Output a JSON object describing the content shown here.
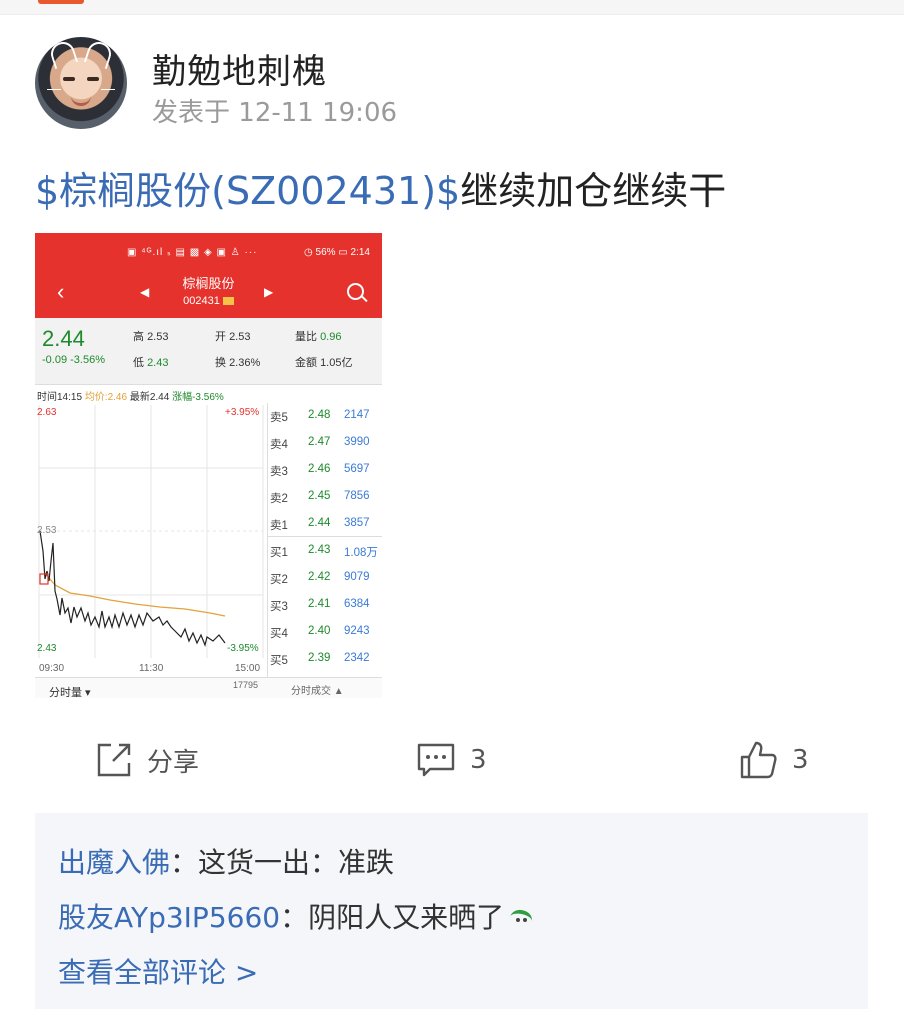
{
  "post": {
    "username": "勤勉地刺槐",
    "time_prefix": "发表于",
    "time": "12-11 19:06",
    "stock_link": "$棕榈股份(SZ002431)$",
    "text": "继续加仓继续干"
  },
  "screenshot": {
    "status_icons": "▣ ⁴ᴳ.ıl ₛ ▤ ▩ ◈ ▣ ♙ ···",
    "status_right": "◷ 56% ▭ 2:14",
    "stock_name": "棕榈股份",
    "stock_code": "002431",
    "price": "2.44",
    "change": "-0.09 -3.56%",
    "high_label": "高",
    "high": "2.53",
    "open_label": "开",
    "open": "2.53",
    "vol_ratio_label": "量比",
    "vol_ratio": "0.96",
    "low_label": "低",
    "low": "2.43",
    "turnover_label": "换",
    "turnover": "2.36%",
    "amount_label": "金额",
    "amount": "1.05亿",
    "info_time": "时间14:15",
    "info_avg": "均价:2.46",
    "info_latest": "最新2.44",
    "info_pct": "涨幅-3.56%",
    "chart_max": "2.63",
    "chart_max_pct": "+3.95%",
    "chart_mid": "2.53",
    "chart_min": "2.43",
    "chart_min_pct": "-3.95%",
    "time_start": "09:30",
    "time_mid": "11:30",
    "time_end": "15:00",
    "tab_fenshi": "分时量 ▾",
    "vol_total": "17795",
    "tab_trades": "分时成交 ▲",
    "order_book": [
      {
        "label": "卖5",
        "price": "2.48",
        "vol": "2147"
      },
      {
        "label": "卖4",
        "price": "2.47",
        "vol": "3990"
      },
      {
        "label": "卖3",
        "price": "2.46",
        "vol": "5697"
      },
      {
        "label": "卖2",
        "price": "2.45",
        "vol": "7856"
      },
      {
        "label": "卖1",
        "price": "2.44",
        "vol": "3857"
      },
      {
        "label": "买1",
        "price": "2.43",
        "vol": "1.08万"
      },
      {
        "label": "买2",
        "price": "2.42",
        "vol": "9079"
      },
      {
        "label": "买3",
        "price": "2.41",
        "vol": "6384"
      },
      {
        "label": "买4",
        "price": "2.40",
        "vol": "9243"
      },
      {
        "label": "买5",
        "price": "2.39",
        "vol": "2342"
      }
    ]
  },
  "actions": {
    "share_label": "分享",
    "comment_count": "3",
    "like_count": "3"
  },
  "comments": [
    {
      "author": "出魔入佛",
      "sep": "：",
      "text": "这货一出：准跌"
    },
    {
      "author": "股友AYp3IP5660",
      "sep": "：",
      "text": "阴阳人又来晒了"
    }
  ],
  "view_all": "查看全部评论 >",
  "colors": {
    "link": "#3a6bb5",
    "red": "#e5322d",
    "green": "#1d8a2b"
  }
}
